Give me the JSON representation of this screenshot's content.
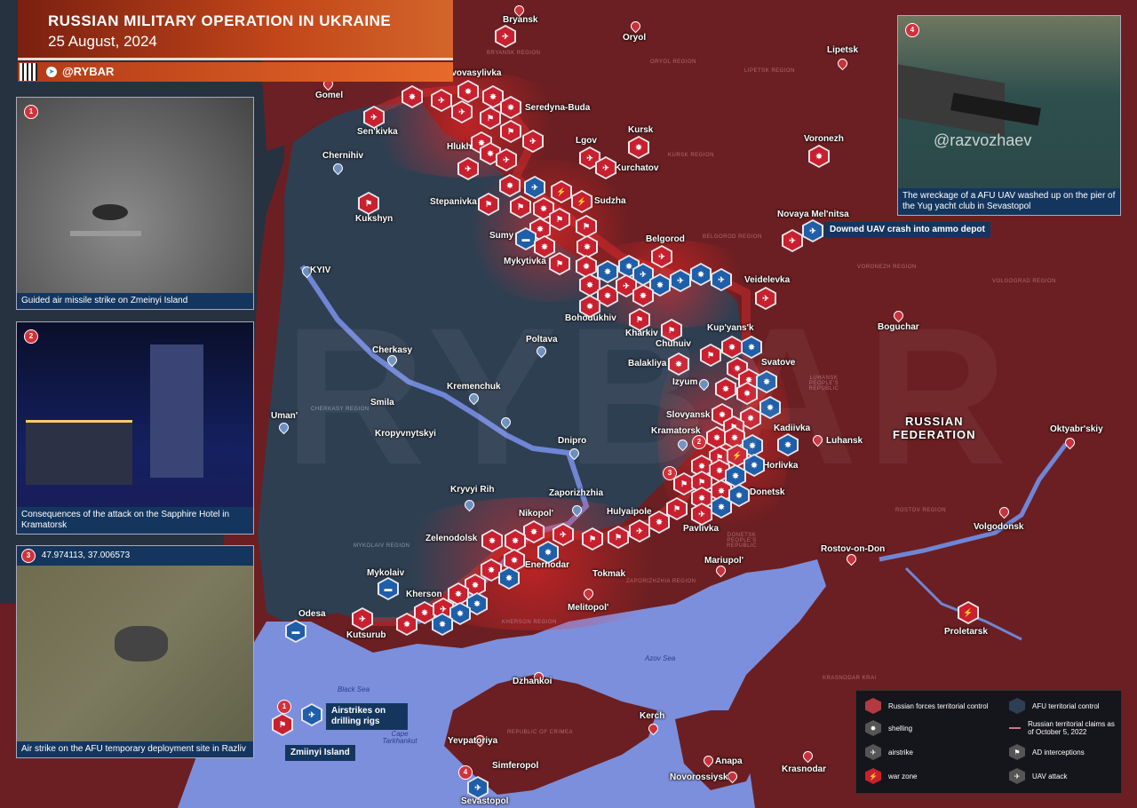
{
  "header": {
    "title": "RUSSIAN MILITARY OPERATION IN UKRAINE",
    "date": "25 August, 2024",
    "brand": "@RYBAR"
  },
  "map": {
    "colors": {
      "russia": "#6b1f22",
      "ukraine": "#2f3f52",
      "sea": "#7c8fdc",
      "river": "#6f86d6",
      "red_marker": "#c8202e",
      "blue_marker": "#1f5ea8"
    },
    "watermark": "RYBAR",
    "country_label": [
      "RUSSIAN",
      "FEDERATION"
    ],
    "cities": [
      {
        "name": "Bryansk"
      },
      {
        "name": "Oryol"
      },
      {
        "name": "Lipetsk"
      },
      {
        "name": "Gomel"
      },
      {
        "name": "Novovasylivka"
      },
      {
        "name": "Seredyna-Buda"
      },
      {
        "name": "Sen'kivka"
      },
      {
        "name": "Chernihiv"
      },
      {
        "name": "Hlukhiv"
      },
      {
        "name": "Lgov"
      },
      {
        "name": "Kursk"
      },
      {
        "name": "Kurchatov"
      },
      {
        "name": "Voronezh"
      },
      {
        "name": "Stepanivka"
      },
      {
        "name": "Sudzha"
      },
      {
        "name": "Kukshyn"
      },
      {
        "name": "Sumy"
      },
      {
        "name": "Novaya Mel'nitsa"
      },
      {
        "name": "Belgorod"
      },
      {
        "name": "Mykytivka"
      },
      {
        "name": "KYIV"
      },
      {
        "name": "Veidelevka"
      },
      {
        "name": "Bohodukhiv"
      },
      {
        "name": "Kharkiv"
      },
      {
        "name": "Chuhuiv"
      },
      {
        "name": "Kup'yans'k"
      },
      {
        "name": "Poltava"
      },
      {
        "name": "Cherkasy"
      },
      {
        "name": "Balakliya"
      },
      {
        "name": "Svatove"
      },
      {
        "name": "Boguchar"
      },
      {
        "name": "Izyum"
      },
      {
        "name": "Kremenchuk"
      },
      {
        "name": "Smila"
      },
      {
        "name": "Uman'"
      },
      {
        "name": "Slovyansk"
      },
      {
        "name": "Kadiivka"
      },
      {
        "name": "Kramatorsk"
      },
      {
        "name": "Luhansk"
      },
      {
        "name": "Kropyvnytskyi"
      },
      {
        "name": "Dnipro"
      },
      {
        "name": "Horlivka"
      },
      {
        "name": "Oktyabr'skiy"
      },
      {
        "name": "Donetsk"
      },
      {
        "name": "Kryvyi Rih"
      },
      {
        "name": "Zaporizhzhia"
      },
      {
        "name": "Nikopol'"
      },
      {
        "name": "Hulyaipole"
      },
      {
        "name": "Pavlivka"
      },
      {
        "name": "Volgodonsk"
      },
      {
        "name": "Zelenodolsk"
      },
      {
        "name": "Enerhodar"
      },
      {
        "name": "Rostov-on-Don"
      },
      {
        "name": "Mariupol'"
      },
      {
        "name": "Tokmak"
      },
      {
        "name": "Mykolaiv"
      },
      {
        "name": "Kherson"
      },
      {
        "name": "Melitopol'"
      },
      {
        "name": "Odesa"
      },
      {
        "name": "Proletarsk"
      },
      {
        "name": "Kutsurub"
      },
      {
        "name": "Dzhankoi"
      },
      {
        "name": "Kerch"
      },
      {
        "name": "Yevpatoriya"
      },
      {
        "name": "Simferopol"
      },
      {
        "name": "Anapa"
      },
      {
        "name": "Novorossiysk"
      },
      {
        "name": "Krasnodar"
      },
      {
        "name": "Sevastopol"
      }
    ],
    "regions": [
      "BRYANSK REGION",
      "ORYOL REGION",
      "LIPETSK REGION",
      "KURSK REGION",
      "BELGOROD REGION",
      "VORONEZH REGION",
      "VOLGOGRAD REGION",
      "CHERKASY REGION",
      "MYKOLAIV REGION",
      "KHERSON REGION",
      "ZAPORIZHZHIA REGION",
      "DONETSK PEOPLE'S REPUBLIC",
      "LUHANSK PEOPLE'S REPUBLIC",
      "ROSTOV REGION",
      "REPUBLIC OF CRIMEA",
      "KRASNODAR KRAI"
    ],
    "seas": {
      "azov": "Azov Sea",
      "black": "Black Sea",
      "cape": "Cape Tarkhankut"
    }
  },
  "insets": [
    {
      "num": "1",
      "caption": "Guided air missile strike on Zmeinyi Island"
    },
    {
      "num": "2",
      "caption": "Consequences of the attack on the Sapphire Hotel in Kramatorsk"
    },
    {
      "num": "3",
      "coords": "47.974113, 37.006573",
      "caption": "Air strike on the AFU temporary deployment site in Razliv"
    },
    {
      "num": "4",
      "watermark": "@razvozhaev",
      "caption": "The wreckage of a AFU UAV washed up on the pier of the Yug yacht club in Sevastopol"
    }
  ],
  "callouts": {
    "uav": "Downed UAV crash into ammo depot",
    "rigs": "Airstrikes on drilling rigs",
    "island": "Zmiinyi Island"
  },
  "markers": {
    "badge_1": "1",
    "badge_2": "2",
    "badge_3": "3",
    "badge_4": "4",
    "count_x2": "x2"
  },
  "legend": {
    "russian_control": "Russian forces territorial control",
    "afu_control": "AFU territorial control",
    "shelling": "shelling",
    "claims": "Russian territorial claims as of October 5, 2022",
    "airstrike": "airstrike",
    "ad": "AD interceptions",
    "war_zone": "war zone",
    "uav": "UAV attack"
  }
}
